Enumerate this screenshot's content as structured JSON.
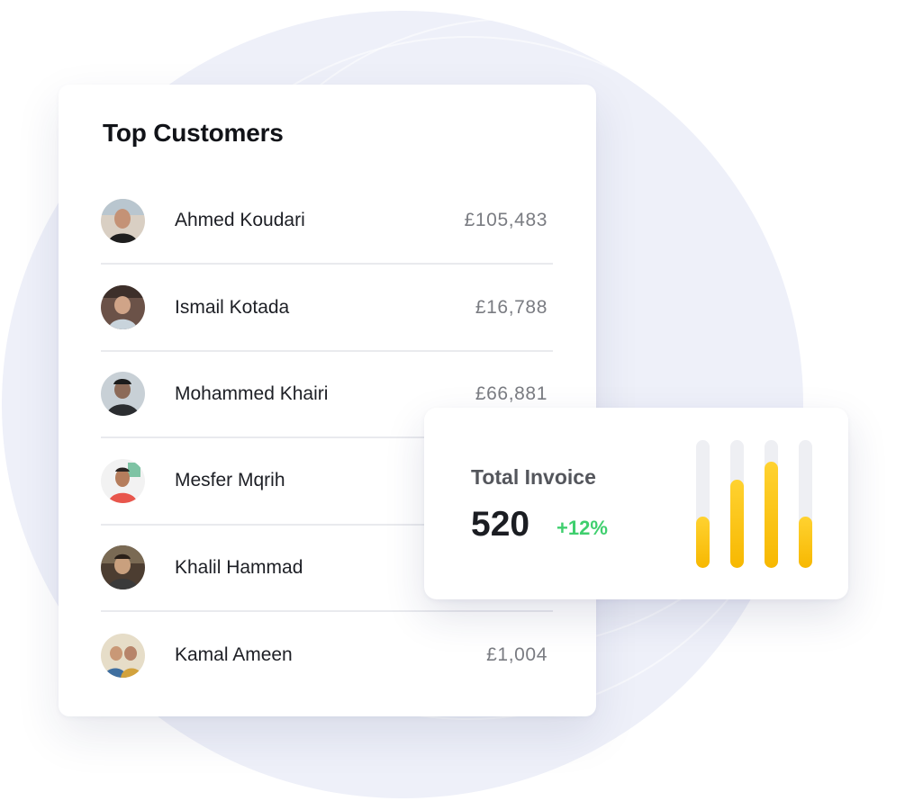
{
  "top_customers": {
    "title": "Top Customers",
    "customers": [
      {
        "name": "Ahmed Koudari",
        "amount": "£105,483",
        "avatar": "avatar-ahmed"
      },
      {
        "name": "Ismail Kotada",
        "amount": "£16,788",
        "avatar": "avatar-ismail"
      },
      {
        "name": "Mohammed Khairi",
        "amount": "£66,881",
        "avatar": "avatar-mohammed"
      },
      {
        "name": "Mesfer Mqrih",
        "amount": "",
        "avatar": "avatar-mesfer"
      },
      {
        "name": "Khalil Hammad",
        "amount": "",
        "avatar": "avatar-khalil"
      },
      {
        "name": "Kamal Ameen",
        "amount": "£1,004",
        "avatar": "avatar-kamal"
      }
    ]
  },
  "total_invoice": {
    "label": "Total Invoice",
    "value": "520",
    "change": "+12%",
    "change_color": "#3fcf6e",
    "bar_levels": [
      0.4,
      0.69,
      0.83,
      0.4
    ],
    "bar_color": "#fbc51a"
  }
}
